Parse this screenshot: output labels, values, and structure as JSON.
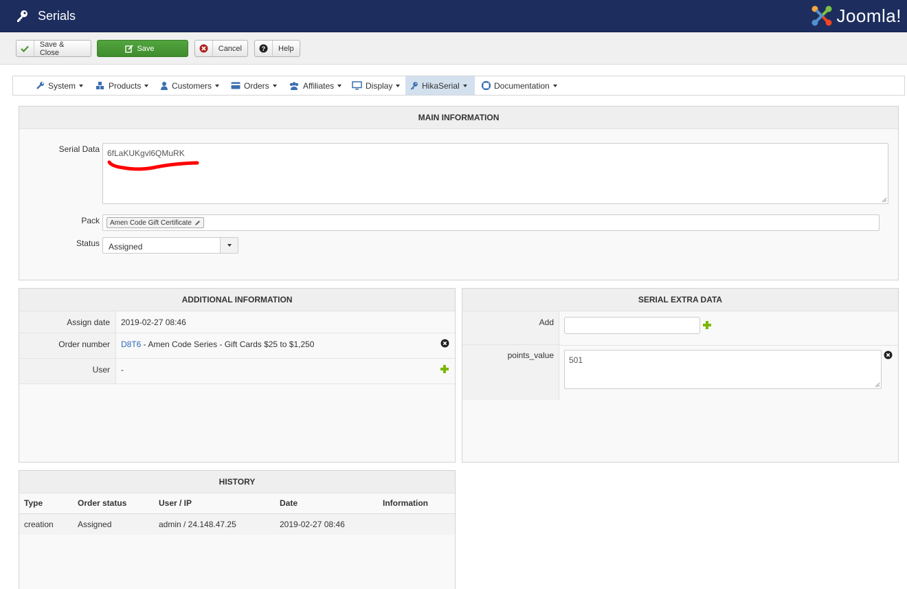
{
  "header": {
    "title": "Serials",
    "logo_text": "Joomla!"
  },
  "toolbar": {
    "save_close": "Save & Close",
    "save": "Save",
    "cancel": "Cancel",
    "help": "Help"
  },
  "nav": {
    "items": [
      "System",
      "Products",
      "Customers",
      "Orders",
      "Affiliates",
      "Display",
      "HikaSerial",
      "Documentation"
    ],
    "active": "HikaSerial"
  },
  "main": {
    "heading": "MAIN INFORMATION",
    "serial_data_label": "Serial Data",
    "serial_data_value": "6fLaKUKgvl6QMuRK",
    "pack_label": "Pack",
    "pack_value": "Amen Code Gift Certificate",
    "status_label": "Status",
    "status_value": "Assigned"
  },
  "additional": {
    "heading": "ADDITIONAL INFORMATION",
    "assign_date_label": "Assign date",
    "assign_date_value": "2019-02-27 08:46",
    "order_number_label": "Order number",
    "order_link": "D8T6",
    "order_desc": " - Amen Code Series - Gift Cards $25 to $1,250",
    "user_label": "User",
    "user_value": "-"
  },
  "extra": {
    "heading": "SERIAL EXTRA DATA",
    "add_label": "Add",
    "add_value": "",
    "points_label": "points_value",
    "points_value": "501"
  },
  "history": {
    "heading": "HISTORY",
    "columns": [
      "Type",
      "Order status",
      "User / IP",
      "Date",
      "Information"
    ],
    "rows": [
      [
        "creation",
        "Assigned",
        "admin / 24.148.47.25",
        "2019-02-27 08:46",
        ""
      ]
    ]
  },
  "colors": {
    "header_bg": "#1c2d5e",
    "save_green": "#46962b",
    "link_blue": "#2a69b8",
    "annotation_red": "#ff0000",
    "plus_green": "#7ab800"
  }
}
